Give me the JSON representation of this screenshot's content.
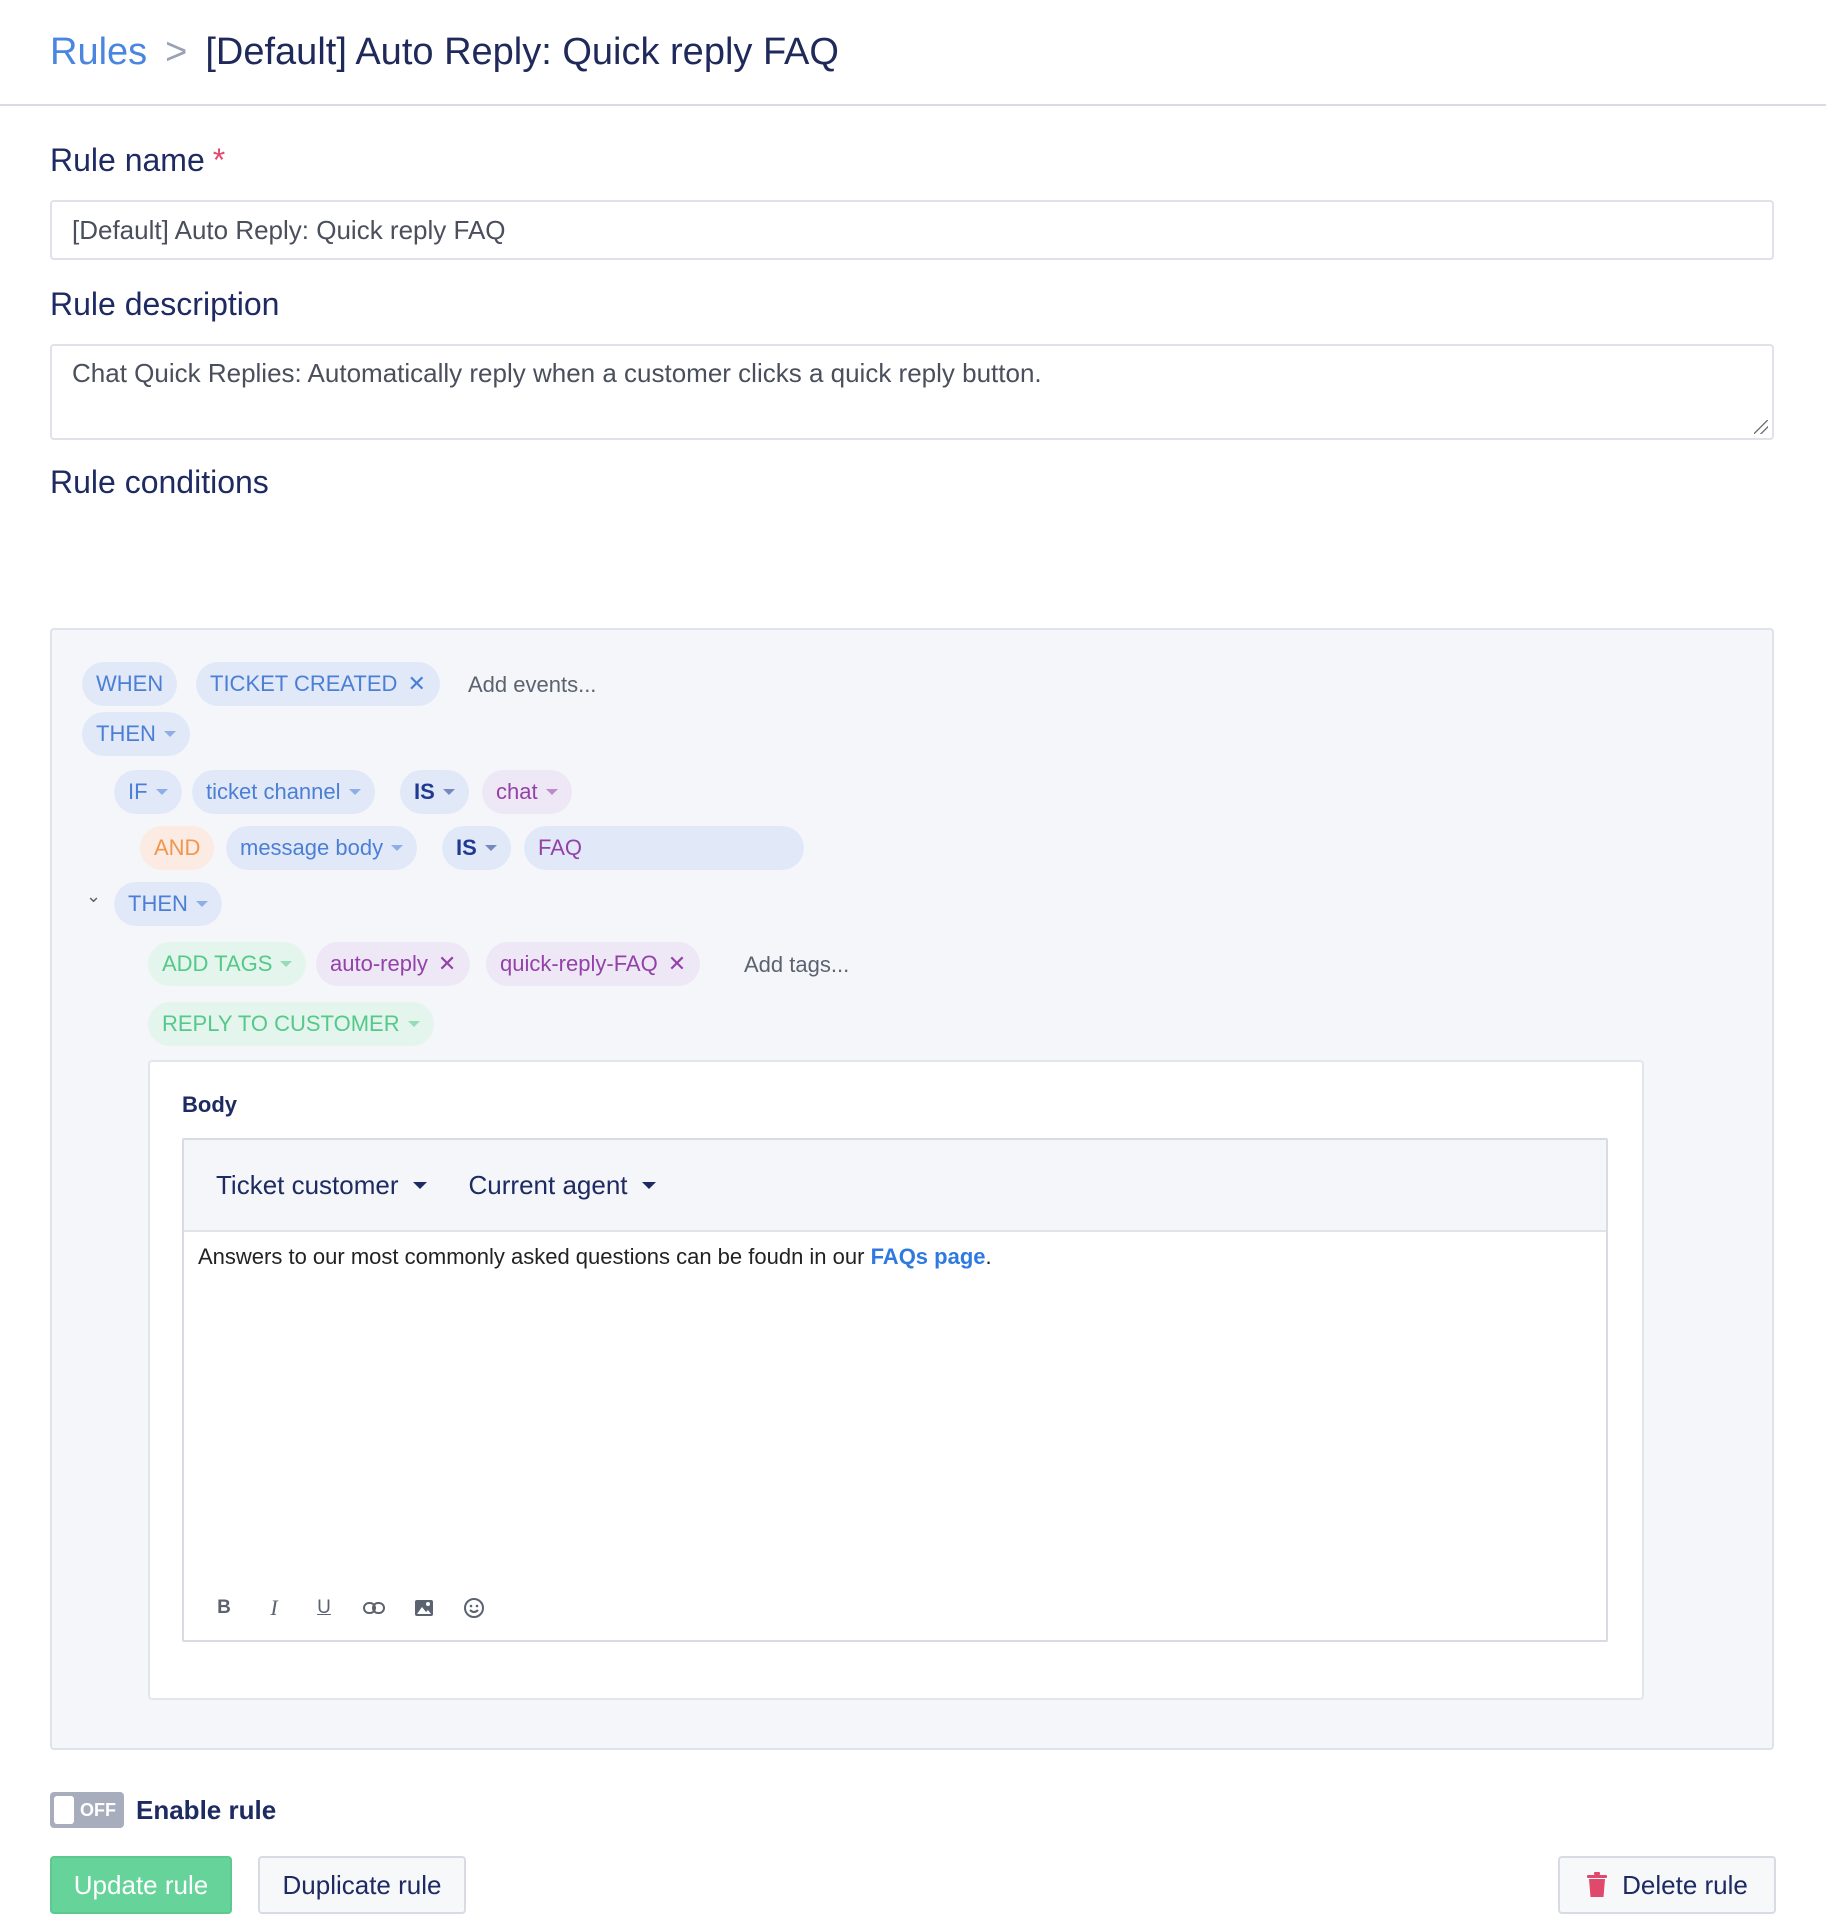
{
  "breadcrumb": {
    "parent": "Rules",
    "separator": ">",
    "current": "[Default] Auto Reply: Quick reply FAQ"
  },
  "rule_name": {
    "label": "Rule name",
    "required_mark": "*",
    "value": "[Default] Auto Reply: Quick reply FAQ"
  },
  "rule_description": {
    "label": "Rule description",
    "value": "Chat Quick Replies: Automatically reply when a customer clicks a quick reply button."
  },
  "rule_conditions": {
    "label": "Rule conditions",
    "when": "WHEN",
    "event": "TICKET CREATED",
    "add_events_placeholder": "Add events...",
    "then_1": "THEN",
    "if": "IF",
    "cond1_field": "ticket channel",
    "cond1_op": "IS",
    "cond1_value": "chat",
    "and": "AND",
    "cond2_field": "message body",
    "cond2_op": "IS",
    "cond2_value": "FAQ",
    "then_2": "THEN",
    "add_tags_action": "ADD TAGS",
    "tags": [
      "auto-reply",
      "quick-reply-FAQ"
    ],
    "add_tags_placeholder": "Add tags...",
    "reply_action": "REPLY TO CUSTOMER"
  },
  "reply_body": {
    "label": "Body",
    "var_dropdown_1": "Ticket customer",
    "var_dropdown_2": "Current agent",
    "text_before": "Answers to our most commonly asked questions can be foudn in our ",
    "link_text": "FAQs page",
    "text_after": ".",
    "format_icons": [
      "bold-icon",
      "italic-icon",
      "underline-icon",
      "link-icon",
      "image-icon",
      "emoji-icon"
    ]
  },
  "enable_toggle": {
    "state_label": "OFF",
    "label": "Enable rule"
  },
  "buttons": {
    "update": "Update rule",
    "duplicate": "Duplicate rule",
    "delete": "Delete rule"
  },
  "colors": {
    "accent_blue": "#4a86e0",
    "success_green": "#66d39a",
    "danger_red": "#e0486c"
  }
}
